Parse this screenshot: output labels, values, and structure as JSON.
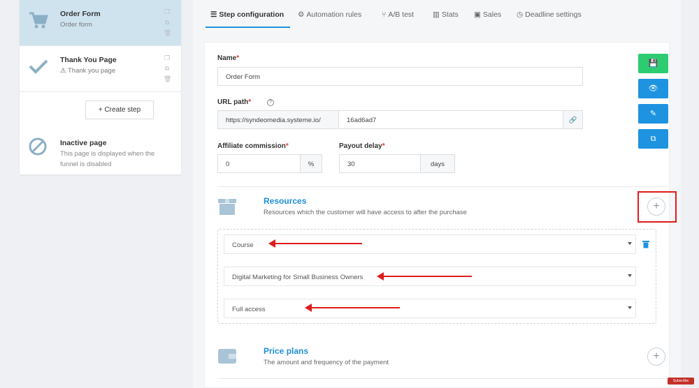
{
  "sidebar": {
    "steps": [
      {
        "title": "Order Form",
        "subtitle": "Order form",
        "icon": "cart-icon",
        "active": true
      },
      {
        "title": "Thank You Page",
        "subtitle": "Thank you page",
        "icon": "check-icon",
        "warning": true,
        "active": false
      }
    ],
    "create_step_label": "+  Create step",
    "inactive": {
      "title": "Inactive page",
      "description": "This page is displayed when the funnel is disabled"
    }
  },
  "tabs": [
    {
      "label": "Step configuration",
      "icon": "list-icon",
      "active": true
    },
    {
      "label": "Automation rules",
      "icon": "gears-icon"
    },
    {
      "label": "A/B test",
      "icon": "branch-icon"
    },
    {
      "label": "Stats",
      "icon": "bar-chart-icon"
    },
    {
      "label": "Sales",
      "icon": "money-icon"
    },
    {
      "label": "Deadline settings",
      "icon": "clock-icon"
    }
  ],
  "form": {
    "name_label": "Name",
    "name_value": "Order Form",
    "url_label": "URL path",
    "url_prefix": "https://syndeomedia.systeme.io/",
    "url_slug": "16ad6ad7",
    "affiliate_label": "Affiliate commission",
    "affiliate_value": "0",
    "affiliate_unit": "%",
    "payout_label": "Payout delay",
    "payout_value": "30",
    "payout_unit": "days"
  },
  "resources": {
    "title": "Resources",
    "subtitle": "Resources which the customer will have access to after the purchase",
    "type_value": "Course",
    "course_value": "Digital Marketing for Small Business Owners",
    "access_value": "Full access"
  },
  "price_plans": {
    "title": "Price plans",
    "subtitle": "The amount and frequency of the payment"
  },
  "badge": {
    "text": "Subscribe"
  },
  "colors": {
    "accent": "#1e93e0",
    "save": "#2ecc71",
    "annotation": "#e01b1b",
    "active_step": "#cfe3ef"
  }
}
